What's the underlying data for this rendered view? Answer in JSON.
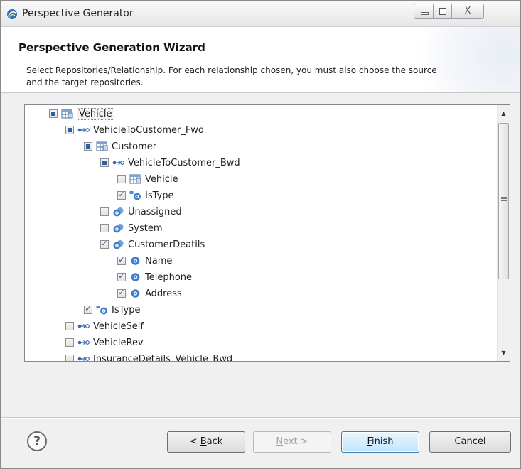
{
  "window": {
    "title": "Perspective Generator",
    "controls": {
      "minimize": "–",
      "maximize": "□",
      "close": "X"
    }
  },
  "header": {
    "title": "Perspective Generation Wizard",
    "description": "Select Repositories/Relationship. For each relationship chosen, you must also choose the source and the target repositories."
  },
  "tree": {
    "items": [
      {
        "label": "Vehicle",
        "icon": "table-icon",
        "state": "grayed",
        "selected": true
      },
      {
        "label": "VehicleToCustomer_Fwd",
        "icon": "relationship-icon",
        "state": "grayed"
      },
      {
        "label": "Customer",
        "icon": "table-icon",
        "state": "grayed"
      },
      {
        "label": "VehicleToCustomer_Bwd",
        "icon": "relationship-icon",
        "state": "grayed"
      },
      {
        "label": "Vehicle",
        "icon": "table-icon",
        "state": "unchecked"
      },
      {
        "label": "IsType",
        "icon": "istype-icon",
        "state": "checked"
      },
      {
        "label": "Unassigned",
        "icon": "attribute-group-icon",
        "state": "unchecked"
      },
      {
        "label": "System",
        "icon": "attribute-group-icon",
        "state": "unchecked"
      },
      {
        "label": "CustomerDeatils",
        "icon": "attribute-group-icon",
        "state": "checked"
      },
      {
        "label": "Name",
        "icon": "attribute-icon",
        "state": "checked"
      },
      {
        "label": "Telephone",
        "icon": "attribute-icon",
        "state": "checked"
      },
      {
        "label": "Address",
        "icon": "attribute-icon",
        "state": "checked"
      },
      {
        "label": "IsType",
        "icon": "istype-icon",
        "state": "checked"
      },
      {
        "label": "VehicleSelf",
        "icon": "relationship-icon",
        "state": "unchecked"
      },
      {
        "label": "VehicleRev",
        "icon": "relationship-icon",
        "state": "unchecked"
      },
      {
        "label": "InsuranceDetails_Vehicle_Bwd",
        "icon": "relationship-icon",
        "state": "unchecked"
      }
    ]
  },
  "buttons": {
    "help": "?",
    "back": {
      "prefix": "< ",
      "mnemonic": "B",
      "rest": "ack"
    },
    "next": {
      "mnemonic": "N",
      "rest": "ext >"
    },
    "finish": {
      "mnemonic": "F",
      "rest": "inish"
    },
    "cancel": "Cancel"
  }
}
